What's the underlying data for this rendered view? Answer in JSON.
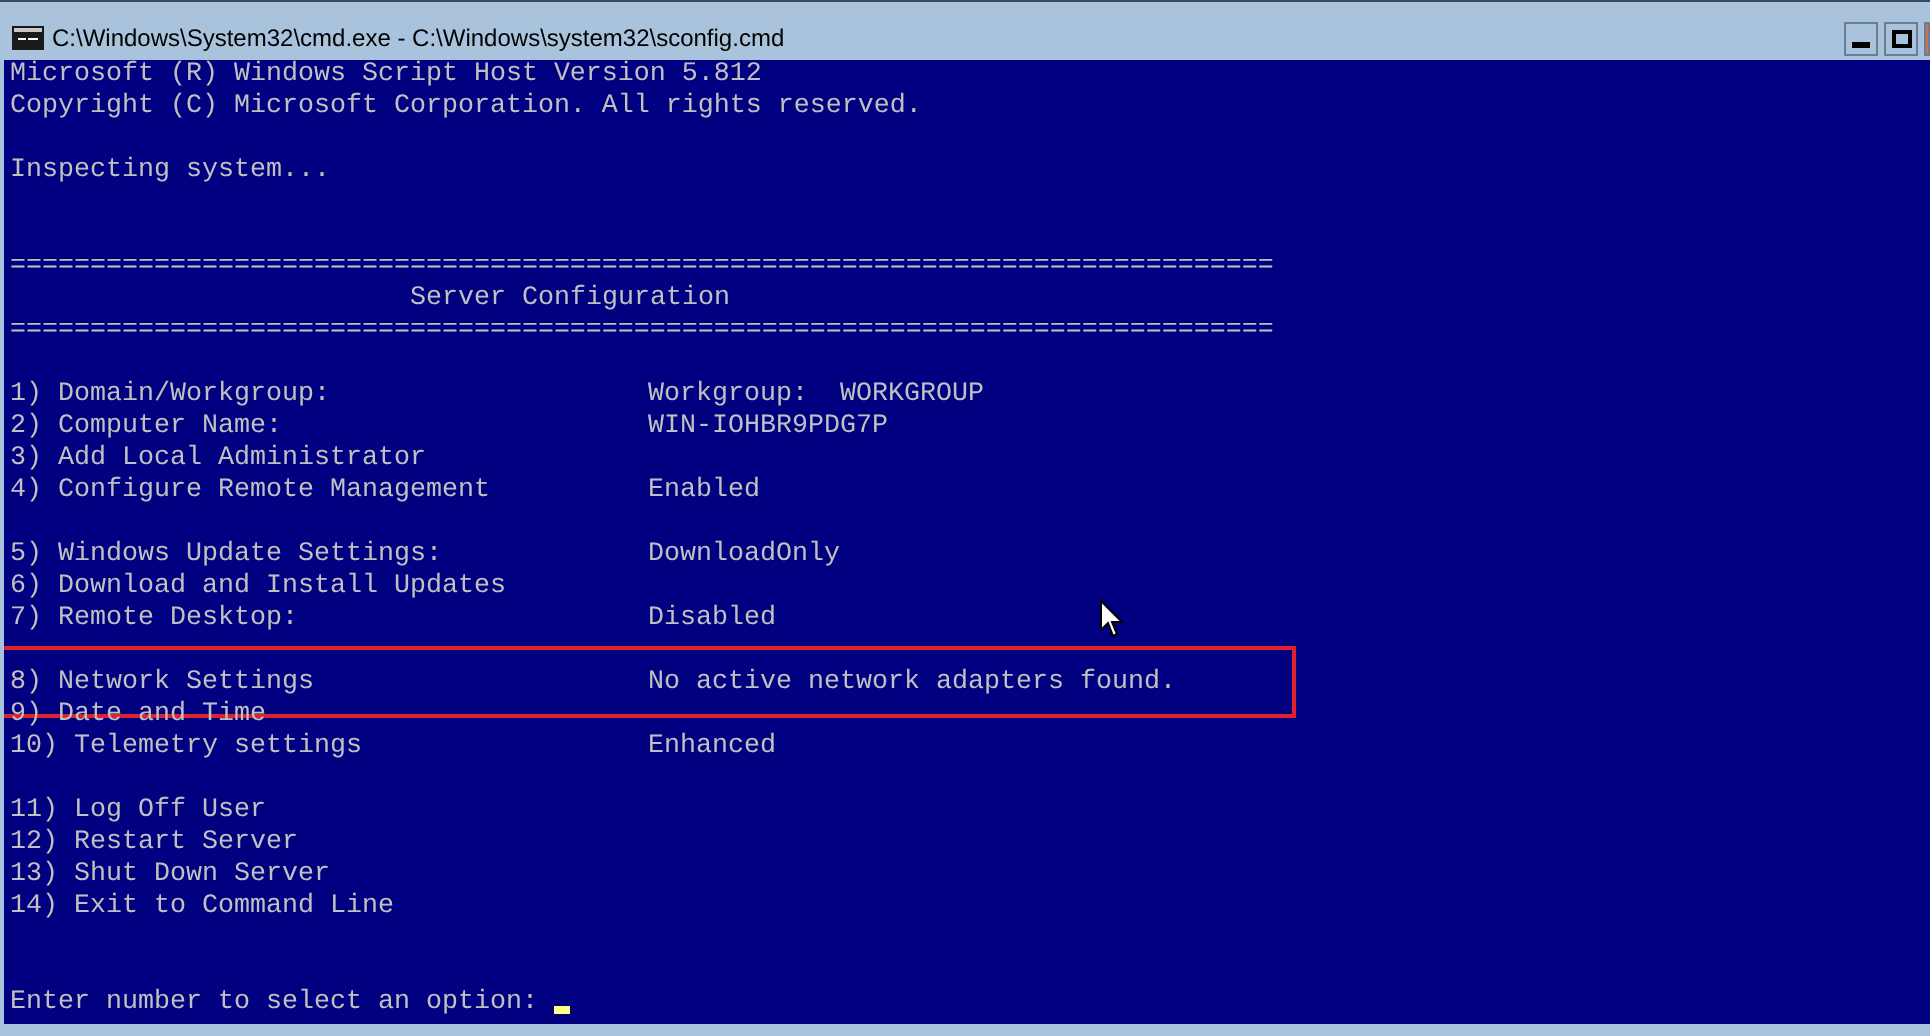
{
  "window": {
    "title": "C:\\Windows\\System32\\cmd.exe - C:\\Windows\\system32\\sconfig.cmd"
  },
  "header_lines": [
    "Microsoft (R) Windows Script Host Version 5.812",
    "Copyright (C) Microsoft Corporation. All rights reserved."
  ],
  "status_line": "Inspecting system...",
  "rule": "===============================================================================",
  "heading": "Server Configuration",
  "menu_groups": [
    [
      {
        "label": "1) Domain/Workgroup:",
        "value": "Workgroup:  WORKGROUP",
        "highlighted": false
      },
      {
        "label": "2) Computer Name:",
        "value": "WIN-IOHBR9PDG7P",
        "highlighted": false
      },
      {
        "label": "3) Add Local Administrator",
        "highlighted": false
      },
      {
        "label": "4) Configure Remote Management",
        "value": "Enabled",
        "highlighted": false
      }
    ],
    [
      {
        "label": "5) Windows Update Settings:",
        "value": "DownloadOnly",
        "highlighted": false
      },
      {
        "label": "6) Download and Install Updates",
        "highlighted": false
      },
      {
        "label": "7) Remote Desktop:",
        "value": "Disabled",
        "highlighted": false
      }
    ],
    [
      {
        "label": "8) Network Settings",
        "value": "No active network adapters found.",
        "highlighted": true
      },
      {
        "label": "9) Date and Time",
        "highlighted": false
      },
      {
        "label": "10) Telemetry settings",
        "value": "Enhanced",
        "highlighted": false
      }
    ],
    [
      {
        "label": "11) Log Off User",
        "highlighted": false
      },
      {
        "label": "12) Restart Server",
        "highlighted": false
      },
      {
        "label": "13) Shut Down Server",
        "highlighted": false
      },
      {
        "label": "14) Exit to Command Line",
        "highlighted": false
      }
    ]
  ],
  "prompt": "Enter number to select an option:"
}
